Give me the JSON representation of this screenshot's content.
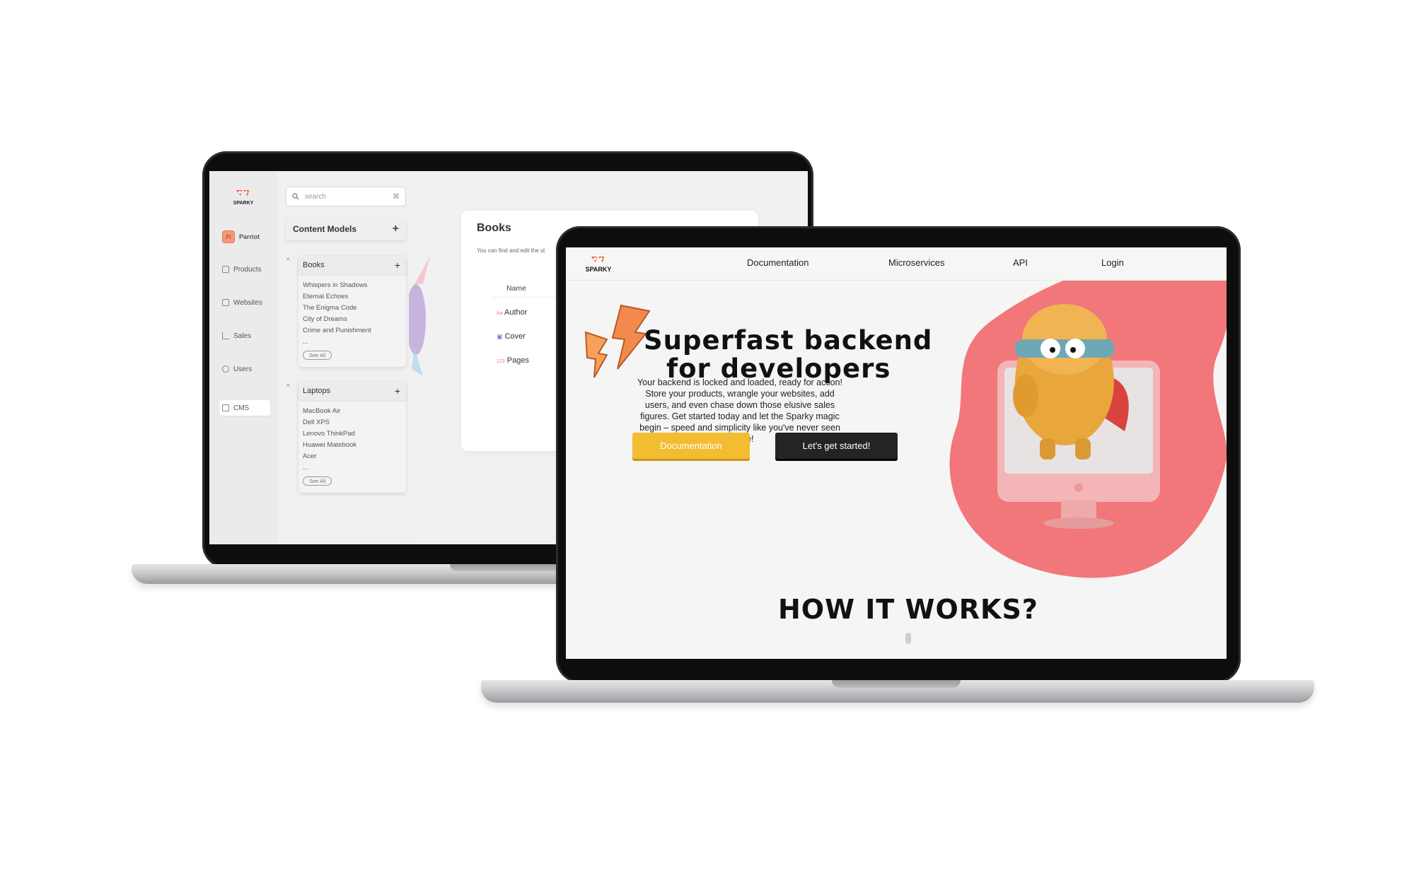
{
  "back_laptop": {
    "logo_text": "SPARKY",
    "project": {
      "chip": "Pt",
      "name": "Parriot"
    },
    "rail_items": [
      {
        "label": "Products",
        "icon": "box-icon"
      },
      {
        "label": "Websites",
        "icon": "monitor-icon"
      },
      {
        "label": "Sales",
        "icon": "chart-icon"
      },
      {
        "label": "Users",
        "icon": "user-icon"
      },
      {
        "label": "CMS",
        "icon": "document-icon"
      }
    ],
    "search": {
      "placeholder": "search",
      "shortcut": "⌘"
    },
    "content_models": {
      "label": "Content Models",
      "add": "+"
    },
    "groups": [
      {
        "title": "Books",
        "items": [
          "Whispers in Shadows",
          "Eternal Echoes",
          "The Enigma Code",
          "City of Dreams",
          "Crime and Punishment",
          "..."
        ],
        "see_all": "See All"
      },
      {
        "title": "Laptops",
        "items": [
          "MacBook Air",
          "Dell XPS",
          "Lenovo ThinkPad",
          "Huawei Matebook",
          "Acer",
          "..."
        ],
        "see_all": "See All"
      }
    ],
    "books_panel": {
      "title": "Books",
      "subtitle": "You can find and edit the st",
      "column": "Name",
      "fields": [
        {
          "type_icon": "Aa",
          "label": "Author"
        },
        {
          "type_icon": "▣",
          "label": "Cover"
        },
        {
          "type_icon": "123",
          "label": "Pages"
        }
      ]
    }
  },
  "front_laptop": {
    "logo_text": "SPARKY",
    "nav": [
      "Documentation",
      "Microservices",
      "API",
      "Login"
    ],
    "hero_line1": "Superfast backend",
    "hero_line2": "for developers",
    "hero_body": "Your backend is locked and loaded, ready for action! Store your products, wrangle your websites, add users, and even chase down those elusive sales figures. Get started today and let the Sparky magic begin – speed and simplicity like you've never seen before!",
    "btn_docs": "Documentation",
    "btn_start": "Let's get started!",
    "how_title": "HOW IT WORKS?"
  },
  "colors": {
    "brand_red": "#f1777a",
    "yellow": "#f2bd30",
    "dark": "#242424",
    "mascot": "#e8a63c"
  }
}
